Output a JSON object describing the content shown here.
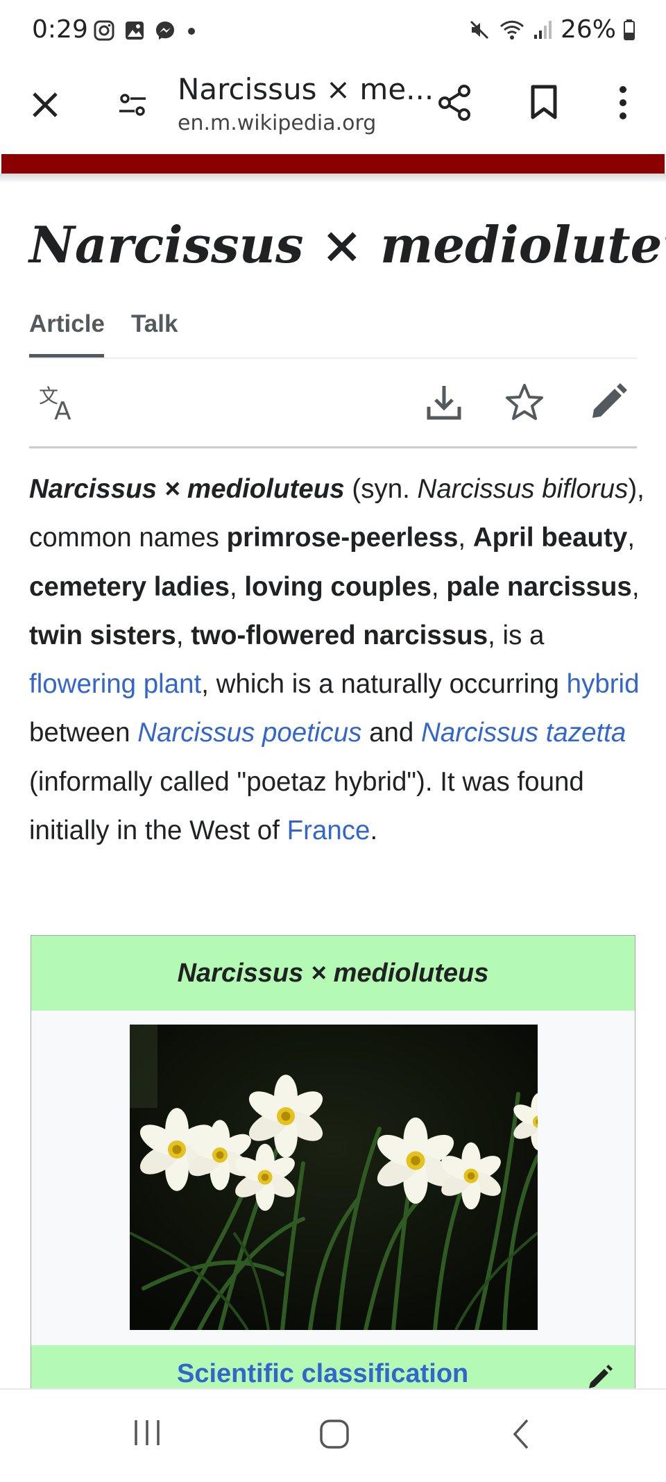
{
  "status_bar": {
    "time": "0:29",
    "left_icons": [
      "instagram-icon",
      "gallery-icon",
      "messenger-icon",
      "dot-icon"
    ],
    "right_icons": [
      "mute-icon",
      "wifi-icon",
      "signal-icon",
      "battery-icon"
    ],
    "battery": "26%"
  },
  "toolbar": {
    "title": "Narcissus × me...",
    "url": "en.m.wikipedia.org",
    "icons": [
      "close-icon",
      "site-settings-icon",
      "share-icon",
      "bookmark-icon",
      "more-vert-icon"
    ]
  },
  "page": {
    "title": "Narcissus × medioluteus",
    "tabs": [
      {
        "label": "Article",
        "active": true
      },
      {
        "label": "Talk",
        "active": false
      }
    ],
    "actions": [
      "language-icon",
      "download-icon",
      "watch-star-icon",
      "edit-icon"
    ]
  },
  "intro": {
    "s1": "Narcissus × medioluteus",
    "s2": " (syn. ",
    "s3": "Narcissus biflorus",
    "s4": "), common names ",
    "s5": "primrose-peerless",
    "s6": ", ",
    "s7": "April beauty",
    "s8": ", ",
    "s9": "cemetery ladies",
    "s10": ", ",
    "s11": "loving couples",
    "s12": ", ",
    "s13": "pale narcissus",
    "s14": ", ",
    "s15": "twin sisters",
    "s16": ", ",
    "s17": "two-flowered narcissus",
    "s18": ", is a ",
    "s19": "flowering plant",
    "s20": ", which is a naturally occurring ",
    "s21": "hybrid",
    "s22": " between ",
    "s23": "Narcissus poeticus",
    "s24": " and ",
    "s25": "Narcissus tazetta",
    "s26": " (informally called \"poetaz hybrid\"). It was found initially in the West of ",
    "s27": "France",
    "s28": "."
  },
  "infobox": {
    "title": "Narcissus × medioluteus",
    "image_subject": "white narcissus flowers with yellow centers",
    "classification_label": "Scientific classification",
    "header_color": "#b4fab4"
  },
  "colors": {
    "accent_bar": "#8b0000",
    "link": "#3366cc",
    "text": "#202122"
  },
  "nav_bar": {
    "icons": [
      "recent-apps-icon",
      "home-icon",
      "back-icon"
    ]
  }
}
